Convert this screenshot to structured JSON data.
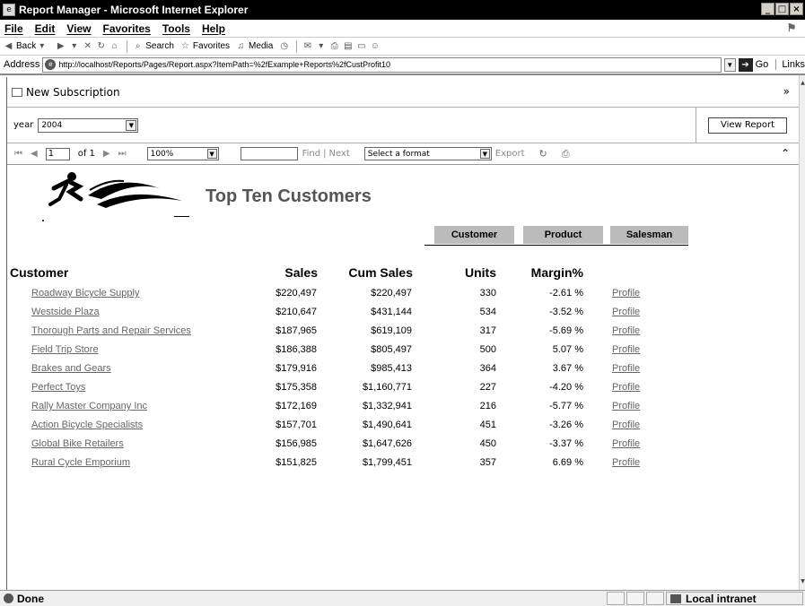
{
  "window": {
    "title": "Report Manager - Microsoft Internet Explorer",
    "controls": [
      "_",
      "□",
      "×"
    ]
  },
  "menu": [
    "File",
    "Edit",
    "View",
    "Favorites",
    "Tools",
    "Help"
  ],
  "toolbar": {
    "back": "Back",
    "search": "Search",
    "favorites": "Favorites",
    "media": "Media"
  },
  "address": {
    "label": "Address",
    "url": "http://localhost/Reports/Pages/Report.aspx?ItemPath=%2fExample+Reports%2fCustProfit10",
    "go": "Go",
    "links": "Links"
  },
  "subscription": {
    "label": "New Subscription"
  },
  "parameters": {
    "year_label": "year",
    "year_value": "2004",
    "view_report": "View Report"
  },
  "navigation": {
    "page": "1",
    "of_pages": "of 1",
    "zoom": "100%",
    "find": "Find",
    "next": "Next",
    "format": "Select a format",
    "export": "Export"
  },
  "report": {
    "title": "Top Ten Customers",
    "sort_tabs": [
      "Customer",
      "Product",
      "Salesman"
    ],
    "headers": {
      "customer": "Customer",
      "sales": "Sales",
      "cum_sales": "Cum Sales",
      "units": "Units",
      "margin": "Margin%"
    },
    "rows": [
      {
        "customer": "Roadway Bicycle Supply",
        "sales": "$220,497",
        "cum_sales": "$220,497",
        "units": "330",
        "margin": "-2.61 %",
        "link": "Profile"
      },
      {
        "customer": "Westside Plaza",
        "sales": "$210,647",
        "cum_sales": "$431,144",
        "units": "534",
        "margin": "-3.52 %",
        "link": "Profile"
      },
      {
        "customer": "Thorough Parts and Repair Services",
        "sales": "$187,965",
        "cum_sales": "$619,109",
        "units": "317",
        "margin": "-5.69 %",
        "link": "Profile"
      },
      {
        "customer": "Field Trip Store",
        "sales": "$186,388",
        "cum_sales": "$805,497",
        "units": "500",
        "margin": "5.07 %",
        "link": "Profile"
      },
      {
        "customer": "Brakes and Gears",
        "sales": "$179,916",
        "cum_sales": "$985,413",
        "units": "364",
        "margin": "3.67 %",
        "link": "Profile"
      },
      {
        "customer": "Perfect Toys",
        "sales": "$175,358",
        "cum_sales": "$1,160,771",
        "units": "227",
        "margin": "-4.20 %",
        "link": "Profile"
      },
      {
        "customer": "Rally Master Company Inc",
        "sales": "$172,169",
        "cum_sales": "$1,332,941",
        "units": "216",
        "margin": "-5.77 %",
        "link": "Profile"
      },
      {
        "customer": "Action Bicycle Specialists",
        "sales": "$157,701",
        "cum_sales": "$1,490,641",
        "units": "451",
        "margin": "-3.26 %",
        "link": "Profile"
      },
      {
        "customer": "Global Bike Retailers",
        "sales": "$156,985",
        "cum_sales": "$1,647,626",
        "units": "450",
        "margin": "-3.37 %",
        "link": "Profile"
      },
      {
        "customer": "Rural Cycle Emporium",
        "sales": "$151,825",
        "cum_sales": "$1,799,451",
        "units": "357",
        "margin": "6.69 %",
        "link": "Profile"
      }
    ]
  },
  "status": {
    "text": "Done",
    "zone": "Local intranet"
  }
}
